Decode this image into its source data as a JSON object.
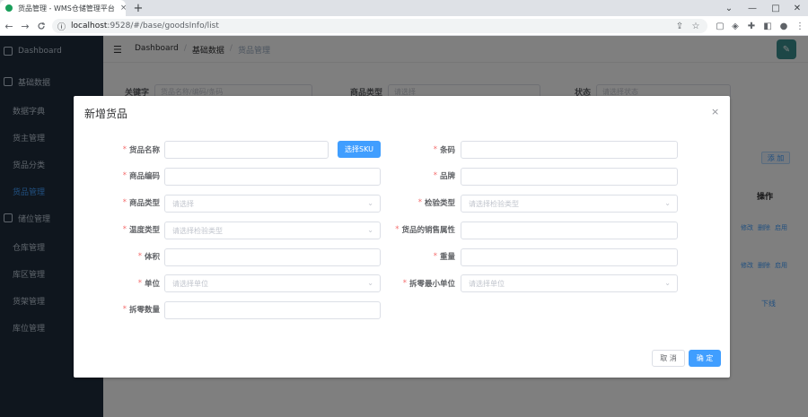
{
  "browser": {
    "tab_title": "货品管理 - WMS仓储管理平台",
    "tab_close": "×",
    "new_tab": "+",
    "url_host": "localhost",
    "url_path": ":9528/#/base/goodsInfo/list",
    "window_controls": [
      "⌄",
      "—",
      "□",
      "✕"
    ],
    "nav": [
      "←",
      "→",
      "C"
    ]
  },
  "sidebar": {
    "items": [
      {
        "label": "Dashboard",
        "type": "top"
      },
      {
        "label": "基础数据",
        "type": "top"
      },
      {
        "label": "数据字典",
        "type": "sub"
      },
      {
        "label": "货主管理",
        "type": "sub"
      },
      {
        "label": "货品分类",
        "type": "sub"
      },
      {
        "label": "货品管理",
        "type": "sub",
        "active": true
      },
      {
        "label": "储位管理",
        "type": "top"
      },
      {
        "label": "仓库管理",
        "type": "sub"
      },
      {
        "label": "库区管理",
        "type": "sub"
      },
      {
        "label": "货架管理",
        "type": "sub"
      },
      {
        "label": "库位管理",
        "type": "sub"
      }
    ]
  },
  "header": {
    "breadcrumb": [
      "Dashboard",
      "基础数据",
      "货品管理"
    ],
    "separator": "/"
  },
  "search": {
    "keyword_label": "关键字",
    "keyword_placeholder": "货品名称/编码/条码",
    "type_label": "商品类型",
    "type_placeholder": "请选择",
    "status_label": "状态",
    "status_placeholder": "请选择状态"
  },
  "background_table": {
    "add_button": "添 加",
    "op_header": "操作",
    "row_actions": [
      "修改",
      "删除",
      "启用"
    ],
    "offline": "下线"
  },
  "dialog": {
    "title": "新增货品",
    "close": "×",
    "fields": {
      "goods_name": {
        "label": "货品名称",
        "placeholder": ""
      },
      "barcode": {
        "label": "条码",
        "placeholder": ""
      },
      "goods_code": {
        "label": "商品编码",
        "placeholder": ""
      },
      "brand": {
        "label": "品牌",
        "placeholder": ""
      },
      "goods_type": {
        "label": "商品类型",
        "placeholder": "请选择"
      },
      "inspect_type": {
        "label": "检验类型",
        "placeholder": "请选择检验类型"
      },
      "temp_type": {
        "label": "温度类型",
        "placeholder": "请选择检验类型"
      },
      "sale_attr": {
        "label": "货品的销售属性",
        "placeholder": ""
      },
      "volume": {
        "label": "体积",
        "placeholder": ""
      },
      "weight": {
        "label": "重量",
        "placeholder": ""
      },
      "unit": {
        "label": "单位",
        "placeholder": "请选择单位"
      },
      "min_unit": {
        "label": "拆零最小单位",
        "placeholder": "请选择单位"
      },
      "split_qty": {
        "label": "拆零数量",
        "placeholder": ""
      }
    },
    "required_mark": "*",
    "sku_button": "选择SKU",
    "cancel_button": "取 消",
    "ok_button": "确 定"
  }
}
